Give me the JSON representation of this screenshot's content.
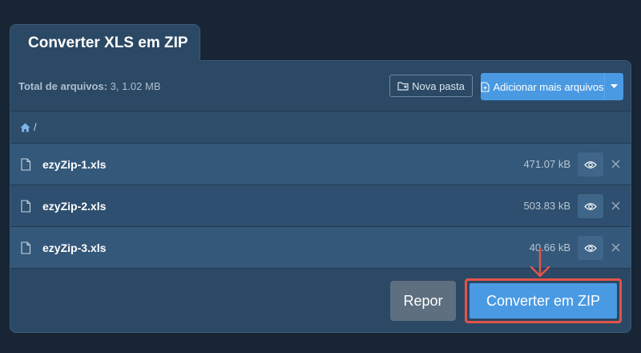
{
  "tab": {
    "title": "Converter XLS em ZIP"
  },
  "header": {
    "total_label": "Total de arquivos:",
    "total_value": "3, 1.02 MB",
    "new_folder_label": "Nova pasta",
    "add_files_label": "Adicionar mais arquivos"
  },
  "breadcrumb": {
    "home_icon": "home-icon",
    "separator": "/"
  },
  "files": [
    {
      "name": "ezyZip-1.xls",
      "size": "471.07 kB"
    },
    {
      "name": "ezyZip-2.xls",
      "size": "503.83 kB"
    },
    {
      "name": "ezyZip-3.xls",
      "size": "40.66 kB"
    }
  ],
  "actions": {
    "reset_label": "Repor",
    "convert_label": "Converter em ZIP"
  },
  "colors": {
    "background": "#172534",
    "panel": "#2b4864",
    "accent": "#4a9ae3",
    "highlight": "#e0544a",
    "reset": "#5e6f80"
  }
}
